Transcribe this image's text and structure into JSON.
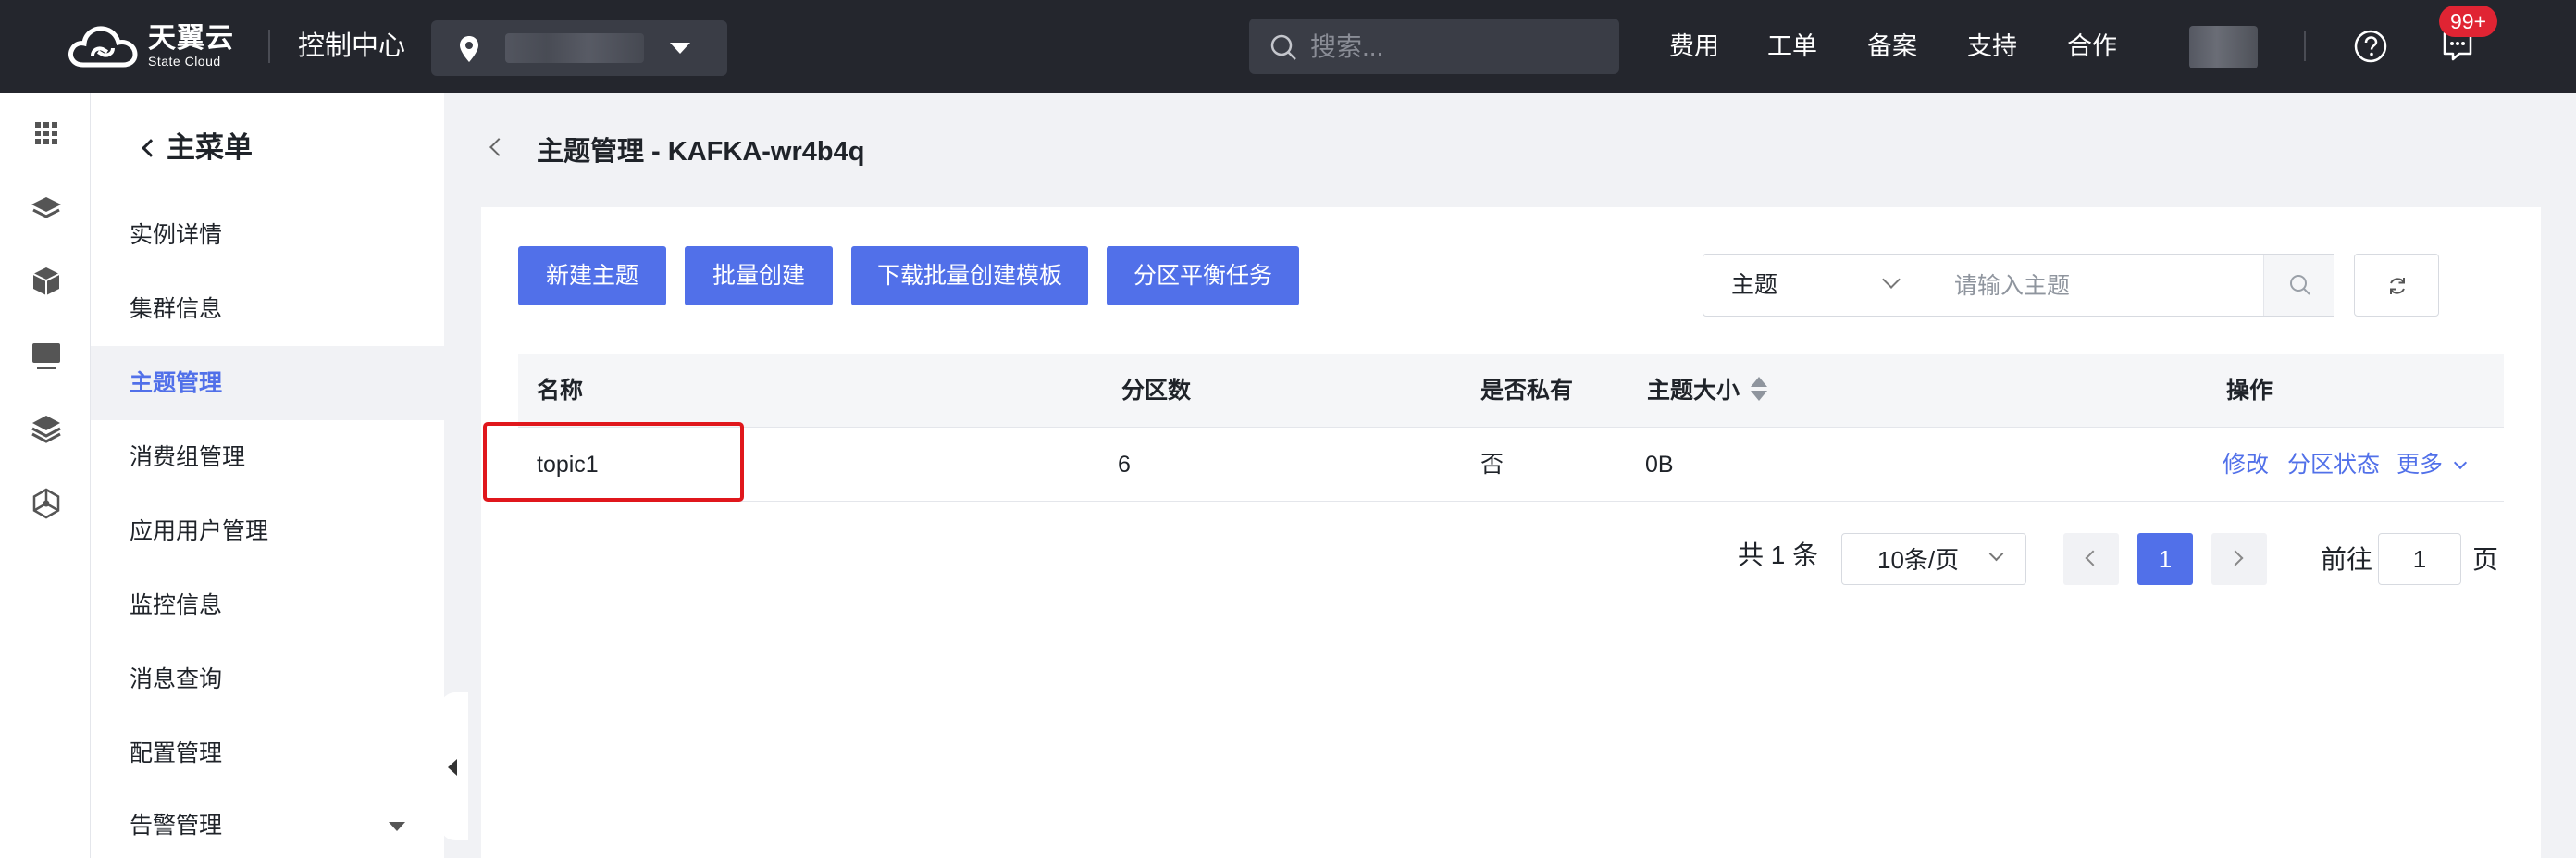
{
  "brand": {
    "name_cn": "天翼云",
    "name_en": "State Cloud",
    "logo_icon": "cloud-icon"
  },
  "header": {
    "console_title": "控制中心",
    "search_placeholder": "搜索...",
    "nav": [
      "费用",
      "工单",
      "备案",
      "支持",
      "合作"
    ],
    "badge": "99+"
  },
  "rail_icons": [
    "grid-icon",
    "layers-icon",
    "cube-icon",
    "monitor-icon",
    "stack-icon",
    "network-icon"
  ],
  "sidebar": {
    "back_label": "主菜单",
    "items": [
      {
        "label": "实例详情"
      },
      {
        "label": "集群信息"
      },
      {
        "label": "主题管理"
      },
      {
        "label": "消费组管理"
      },
      {
        "label": "应用用户管理"
      },
      {
        "label": "监控信息"
      },
      {
        "label": "消息查询"
      },
      {
        "label": "配置管理"
      },
      {
        "label": "告警管理"
      }
    ],
    "active_index": 2
  },
  "page": {
    "title": "主题管理 - KAFKA-wr4b4q"
  },
  "toolbar": {
    "buttons": [
      "新建主题",
      "批量创建",
      "下载批量创建模板",
      "分区平衡任务"
    ],
    "filter_field": "主题",
    "filter_placeholder": "请输入主题"
  },
  "table": {
    "columns": [
      "名称",
      "分区数",
      "是否私有",
      "主题大小",
      "操作"
    ],
    "rows": [
      {
        "name": "topic1",
        "partitions": "6",
        "private": "否",
        "size": "0B",
        "actions": [
          "修改",
          "分区状态",
          "更多"
        ]
      }
    ]
  },
  "pagination": {
    "total": "共 1 条",
    "page_size": "10条/页",
    "current_page": "1",
    "goto_label": "前往",
    "goto_value": "1",
    "page_unit": "页"
  },
  "colors": {
    "accent": "#5170e9",
    "topbar": "#24262d",
    "highlight": "#e0171c",
    "badge": "#e02433"
  }
}
